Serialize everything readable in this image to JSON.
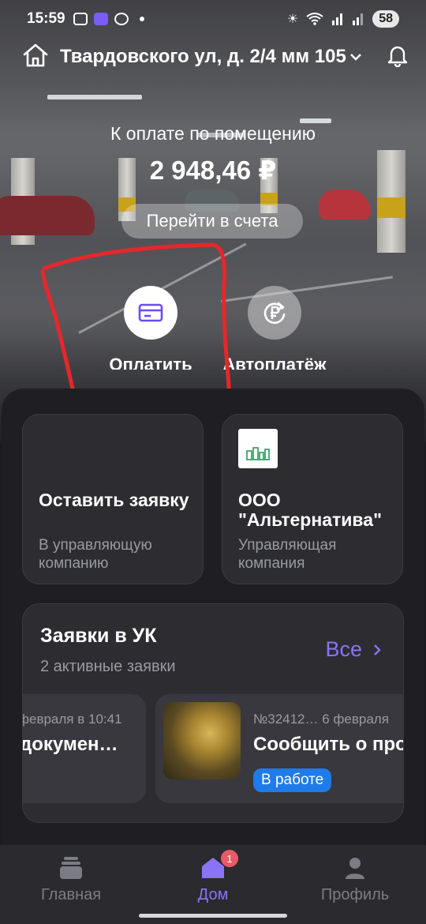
{
  "status_bar": {
    "time": "15:59",
    "battery": "58"
  },
  "header": {
    "address": "Твардовского ул, д. 2/4 мм 105"
  },
  "balance": {
    "label": "К оплате по помещению",
    "amount": "2 948,46 ₽",
    "go_bills_label": "Перейти в счета"
  },
  "actions": [
    {
      "label": "Оплатить",
      "icon": "card-icon"
    },
    {
      "label": "Автоплатёж",
      "icon": "autopay-ruble-icon"
    }
  ],
  "cards": {
    "request": {
      "title": "Оставить заявку",
      "subtitle": "В управляющую компанию"
    },
    "company": {
      "title": "ООО \"Альтернатива\"",
      "subtitle": "Управляющая компания",
      "logo_color": "#3aa56a"
    }
  },
  "requests": {
    "title": "Заявки в УК",
    "subtitle": "2 активные заявки",
    "all_label": "Все",
    "items": [
      {
        "meta": "февраля в 10:41",
        "title": "докумен…"
      },
      {
        "meta": "№32412… 6 февраля",
        "title": "Сообщить о про",
        "status": "В работе"
      }
    ]
  },
  "nav": {
    "items": [
      {
        "label": "Главная"
      },
      {
        "label": "Дом",
        "badge": "1"
      },
      {
        "label": "Профиль"
      }
    ],
    "active_color": "#8b73f7"
  },
  "colors": {
    "accent": "#8b73f7",
    "status_blue": "#1f7be8",
    "annotation_red": "#e8262a"
  }
}
